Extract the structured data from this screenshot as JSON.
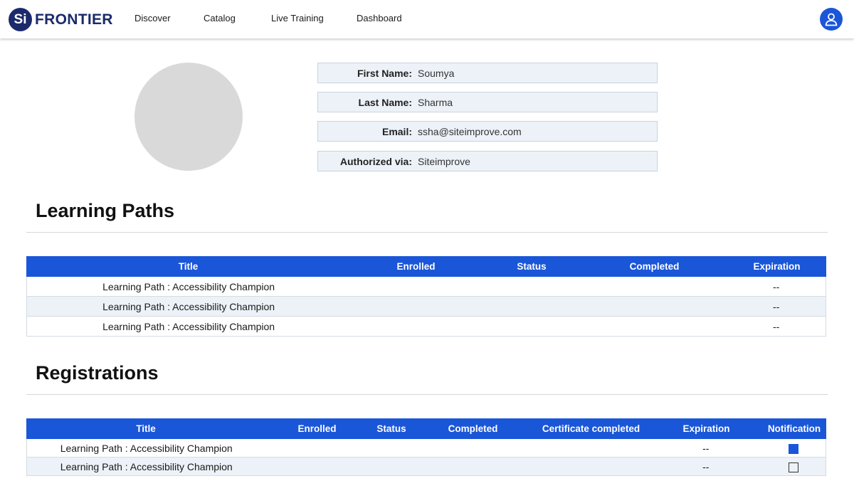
{
  "brand": {
    "badge": "Si",
    "name": "FRONTIER"
  },
  "nav": [
    "Discover",
    "Catalog",
    "Live Training",
    "Dashboard"
  ],
  "profile": {
    "fields": [
      {
        "label": "First Name:",
        "value": "Soumya"
      },
      {
        "label": "Last Name:",
        "value": "Sharma"
      },
      {
        "label": "Email:",
        "value": "ssha@siteimprove.com"
      },
      {
        "label": "Authorized via:",
        "value": "Siteimprove"
      }
    ]
  },
  "learning_paths": {
    "heading": "Learning Paths",
    "columns": [
      "Title",
      "Enrolled",
      "Status",
      "Completed",
      "Expiration"
    ],
    "rows": [
      {
        "title": "Learning Path : Accessibility Champion",
        "enrolled": "",
        "status": "",
        "completed": "",
        "expiration": "--"
      },
      {
        "title": "Learning Path : Accessibility Champion",
        "enrolled": "",
        "status": "",
        "completed": "",
        "expiration": "--"
      },
      {
        "title": "Learning Path : Accessibility Champion",
        "enrolled": "",
        "status": "",
        "completed": "",
        "expiration": "--"
      }
    ]
  },
  "registrations": {
    "heading": "Registrations",
    "columns": [
      "Title",
      "Enrolled",
      "Status",
      "Completed",
      "Certificate completed",
      "Expiration",
      "Notification"
    ],
    "rows": [
      {
        "title": "Learning Path : Accessibility Champion",
        "enrolled": "",
        "status": "",
        "completed": "",
        "certificate": "",
        "expiration": "--",
        "notification": true
      },
      {
        "title": "Learning Path : Accessibility Champion",
        "enrolled": "",
        "status": "",
        "completed": "",
        "certificate": "",
        "expiration": "--",
        "notification": false
      }
    ]
  },
  "colors": {
    "brand": "#1b2a6b",
    "accent": "#1a56d8",
    "row_alt": "#ecf2f8"
  },
  "icons": {
    "user": "user-icon"
  }
}
